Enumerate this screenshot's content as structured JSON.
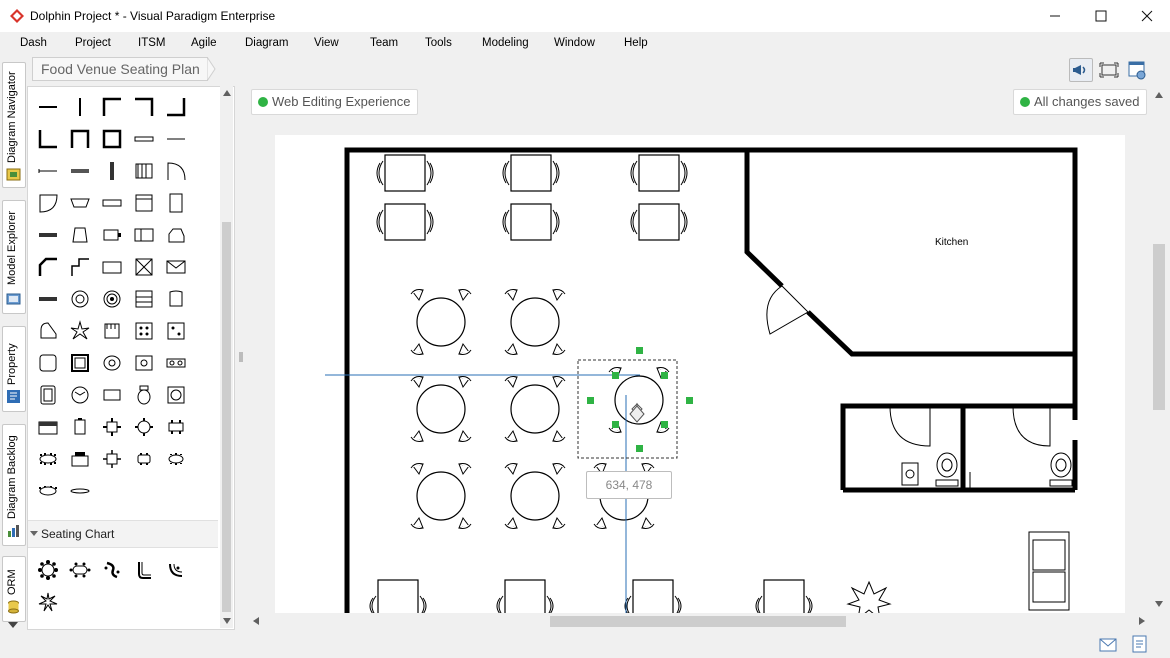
{
  "window": {
    "title": "Dolphin Project * - Visual Paradigm Enterprise",
    "controls": [
      "minimize",
      "maximize",
      "close"
    ]
  },
  "menu": [
    "Dash",
    "Project",
    "ITSM",
    "Agile",
    "Diagram",
    "View",
    "Team",
    "Tools",
    "Modeling",
    "Window",
    "Help"
  ],
  "breadcrumb": "Food Venue Seating Plan",
  "left_tabs": [
    "Diagram Navigator",
    "Model Explorer",
    "Property",
    "Diagram Backlog",
    "ORM"
  ],
  "palette": {
    "section_title": "Seating Chart"
  },
  "canvas": {
    "mode_badge": "Web Editing Experience",
    "save_status": "All changes saved",
    "coordinate_tooltip": "634, 478",
    "room_label": "Kitchen"
  },
  "colors": {
    "status_green": "#2fb344",
    "selection_handle": "#2fb344",
    "guide_line": "#2a6fb5",
    "wall": "#000000"
  }
}
